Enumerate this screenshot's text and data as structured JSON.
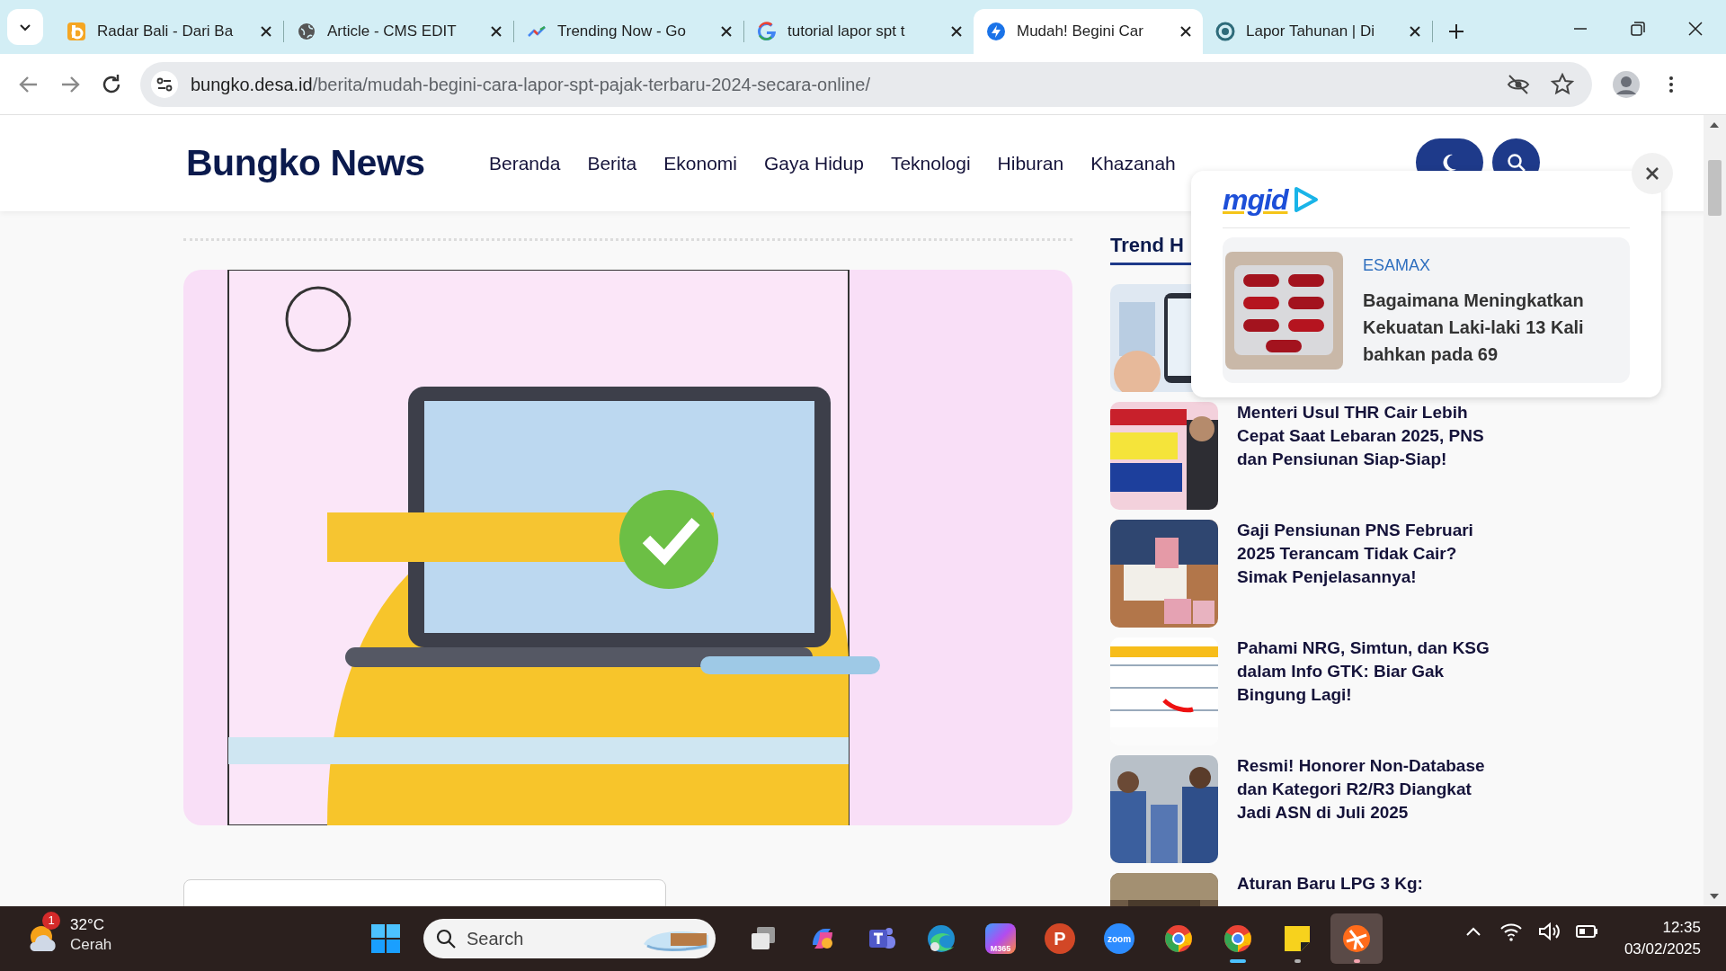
{
  "browser": {
    "tabs": [
      {
        "kind": "b-logo",
        "title": "Radar Bali - Dari Ba",
        "selected": false
      },
      {
        "kind": "globe",
        "title": "Article - CMS EDIT",
        "selected": false
      },
      {
        "kind": "trend",
        "title": "Trending Now - Go",
        "selected": false
      },
      {
        "kind": "google",
        "title": "tutorial lapor spt t",
        "selected": false
      },
      {
        "kind": "bolt",
        "title": "Mudah! Begini Car",
        "selected": true
      },
      {
        "kind": "ring",
        "title": "Lapor Tahunan | Di",
        "selected": false
      }
    ],
    "url_host": "bungko.desa.id",
    "url_path": "/berita/mudah-begini-cara-lapor-spt-pajak-terbaru-2024-secara-online/"
  },
  "site": {
    "logo": "Bungko News",
    "nav": [
      "Beranda",
      "Berita",
      "Ekonomi",
      "Gaya Hidup",
      "Teknologi",
      "Hiburan",
      "Khazanah"
    ]
  },
  "sidebar": {
    "heading": "Trend H",
    "items": [
      {
        "kind": "chart"
      },
      {
        "kind": "news",
        "title": "Menteri Usul THR Cair Lebih Cepat Saat Lebaran 2025, PNS dan Pensiunan Siap-Siap!"
      },
      {
        "kind": "money",
        "title": "Gaji Pensiunan PNS Februari 2025 Terancam Tidak Cair? Simak Penjelasannya!"
      },
      {
        "kind": "form",
        "title": "Pahami NRG, Simtun, dan KSG dalam Info GTK: Biar Gak Bingung Lagi!"
      },
      {
        "kind": "crowd",
        "title": "Resmi! Honorer Non-Database dan Kategori R2/R3 Diangkat Jadi ASN di Juli 2025"
      },
      {
        "kind": "table",
        "title": "Aturan Baru LPG 3 Kg:"
      }
    ]
  },
  "ad": {
    "brand": "mgid",
    "source": "ESAMAX",
    "title": "Bagaimana Meningkatkan Kekuatan Laki-laki 13 Kali bahkan pada 69"
  },
  "taskbar": {
    "weather": {
      "badge": "1",
      "temperature": "32°C",
      "condition": "Cerah"
    },
    "search_placeholder": "Search",
    "apps": [
      {
        "kind": "windows",
        "open": false,
        "focused": false,
        "selected": false
      },
      {
        "kind": "copilot",
        "open": false,
        "focused": false,
        "selected": false
      },
      {
        "kind": "teams",
        "open": false,
        "focused": false,
        "selected": false
      },
      {
        "kind": "edge",
        "open": false,
        "focused": false,
        "selected": false
      },
      {
        "kind": "m365",
        "label": "M365",
        "open": false,
        "focused": false,
        "selected": false
      },
      {
        "kind": "powerpoint",
        "label": "P",
        "open": false,
        "focused": false,
        "selected": false
      },
      {
        "kind": "zoom",
        "label": "zoom",
        "open": false,
        "focused": false,
        "selected": false
      },
      {
        "kind": "chrome",
        "open": false,
        "focused": false,
        "selected": false
      },
      {
        "kind": "chrome",
        "open": true,
        "focused": true,
        "selected": false
      },
      {
        "kind": "notes",
        "open": true,
        "focused": false,
        "selected": false
      },
      {
        "kind": "fan",
        "open": true,
        "focused": false,
        "selected": true
      }
    ],
    "time": "12:35",
    "date": "03/02/2025"
  }
}
